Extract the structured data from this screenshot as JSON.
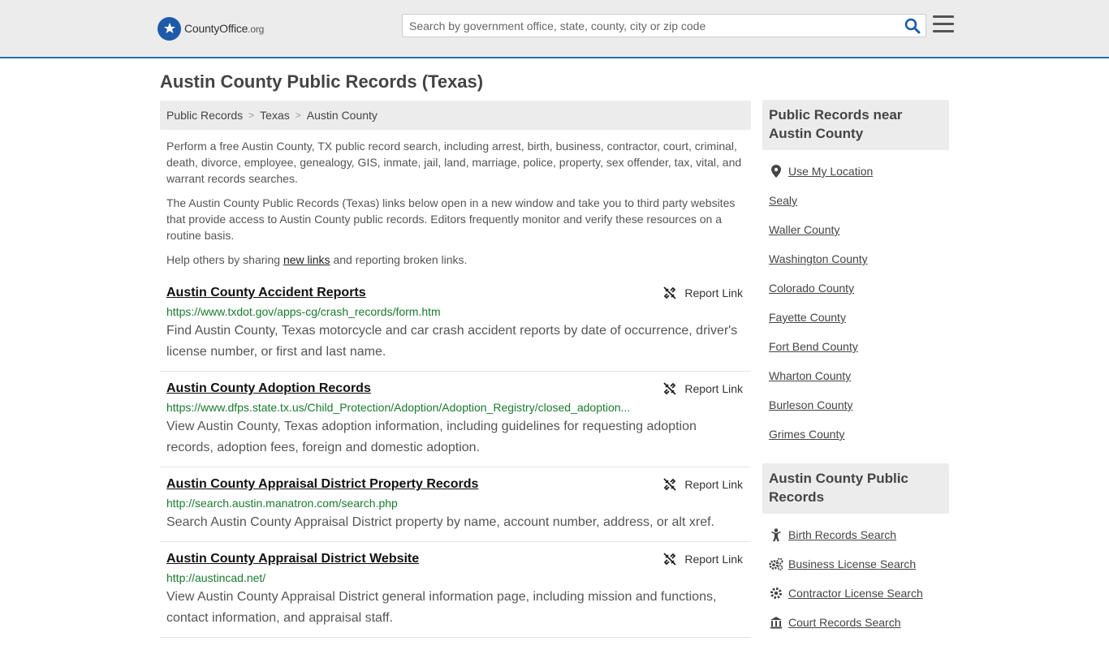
{
  "header": {
    "logo_main": "CountyOffice",
    "logo_tld": ".org",
    "search_placeholder": "Search by government office, state, county, city or zip code"
  },
  "page_title": "Austin County Public Records (Texas)",
  "breadcrumb": [
    "Public Records",
    "Texas",
    "Austin County"
  ],
  "intro": {
    "p1": "Perform a free Austin County, TX public record search, including arrest, birth, business, contractor, court, criminal, death, divorce, employee, genealogy, GIS, inmate, jail, land, marriage, police, property, sex offender, tax, vital, and warrant records searches.",
    "p2": "The Austin County Public Records (Texas) links below open in a new window and take you to third party websites that provide access to Austin County public records. Editors frequently monitor and verify these resources on a routine basis.",
    "p3_before": "Help others by sharing ",
    "p3_link": "new links",
    "p3_after": " and reporting broken links."
  },
  "report_label": "Report Link",
  "records": [
    {
      "title": "Austin County Accident Reports",
      "url": "https://www.txdot.gov/apps-cg/crash_records/form.htm",
      "desc": "Find Austin County, Texas motorcycle and car crash accident reports by date of occurrence, driver's license number, or first and last name."
    },
    {
      "title": "Austin County Adoption Records",
      "url": "https://www.dfps.state.tx.us/Child_Protection/Adoption/Adoption_Registry/closed_adoption...",
      "desc": "View Austin County, Texas adoption information, including guidelines for requesting adoption records, adoption fees, foreign and domestic adoption."
    },
    {
      "title": "Austin County Appraisal District Property Records",
      "url": "http://search.austin.manatron.com/search.php",
      "desc": "Search Austin County Appraisal District property by name, account number, address, or alt xref."
    },
    {
      "title": "Austin County Appraisal District Website",
      "url": "http://austincad.net/",
      "desc": "View Austin County Appraisal District general information page, including mission and functions, contact information, and appraisal staff."
    }
  ],
  "sidebar": {
    "near_heading": "Public Records near Austin County",
    "use_location": "Use My Location",
    "near": [
      "Sealy",
      "Waller County",
      "Washington County",
      "Colorado County",
      "Fayette County",
      "Fort Bend County",
      "Wharton County",
      "Burleson County",
      "Grimes County"
    ],
    "records_heading": "Austin County Public Records",
    "records_links": [
      {
        "label": "Birth Records Search",
        "icon": "baby-icon"
      },
      {
        "label": "Business License Search",
        "icon": "gears-icon"
      },
      {
        "label": "Contractor License Search",
        "icon": "gear-icon"
      },
      {
        "label": "Court Records Search",
        "icon": "courthouse-icon"
      }
    ]
  }
}
